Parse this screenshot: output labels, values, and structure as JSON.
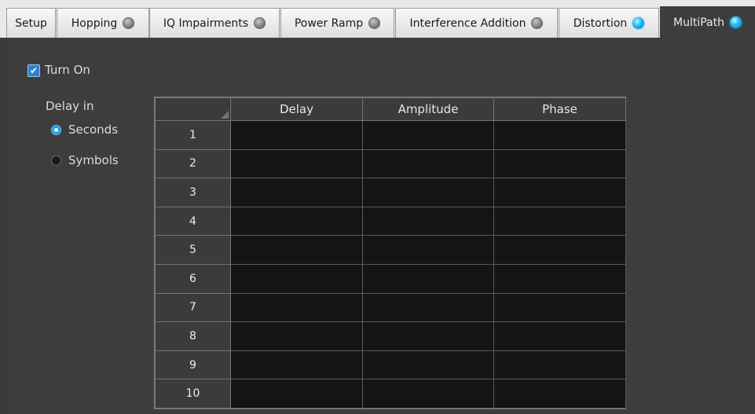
{
  "tabs": [
    {
      "label": "Setup",
      "indicator": "none"
    },
    {
      "label": "Hopping",
      "indicator": "off"
    },
    {
      "label": "IQ Impairments",
      "indicator": "off"
    },
    {
      "label": "Power Ramp",
      "indicator": "off"
    },
    {
      "label": "Interference Addition",
      "indicator": "off"
    },
    {
      "label": "Distortion",
      "indicator": "on"
    },
    {
      "label": "MultiPath",
      "indicator": "on",
      "active": true
    }
  ],
  "multipath": {
    "turn_on_label": "Turn On",
    "turn_on_checked": true,
    "delay_in_label": "Delay in",
    "delay_options": [
      {
        "label": "Seconds",
        "selected": true
      },
      {
        "label": "Symbols",
        "selected": false
      }
    ],
    "table": {
      "columns": [
        "Delay",
        "Amplitude",
        "Phase"
      ],
      "rows": [
        "1",
        "2",
        "3",
        "4",
        "5",
        "6",
        "7",
        "8",
        "9",
        "10"
      ]
    }
  },
  "colors": {
    "panel_bg": "#3d3d3d",
    "led_on": "#19b8f0",
    "led_off": "#7b7b7b",
    "cell_bg": "#141414"
  }
}
